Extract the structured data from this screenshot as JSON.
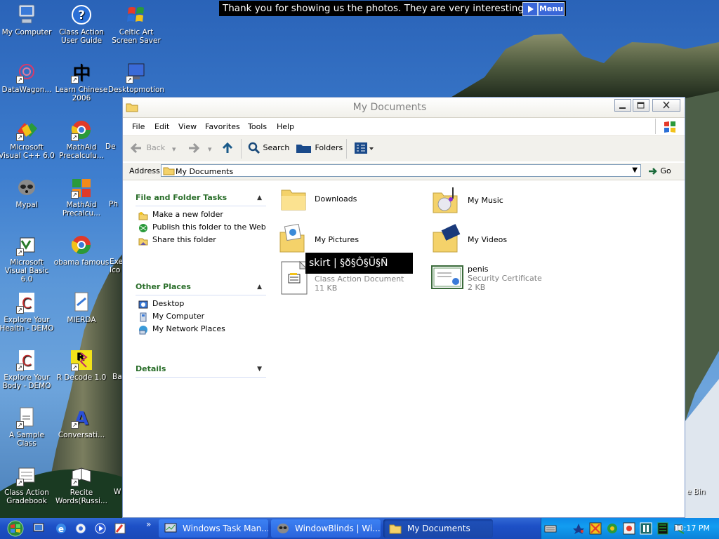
{
  "banner": {
    "text": "Thank you for showing us the photos. They are very interesting.",
    "menu_label": "Menu"
  },
  "desktop_icons": [
    {
      "label": "My Computer"
    },
    {
      "label": "Class Action User Guide"
    },
    {
      "label": "Celtic Art Screen Saver"
    },
    {
      "label": "DataWagon..."
    },
    {
      "label": "Learn Chinese 2006"
    },
    {
      "label": "Desktopmotion"
    },
    {
      "label": "Microsoft Visual C++ 6.0"
    },
    {
      "label": "MathAid Precalculu..."
    },
    {
      "label": "Mypal"
    },
    {
      "label": "MathAid Precalcu..."
    },
    {
      "label": "Microsoft Visual Basic 6.0"
    },
    {
      "label": "obama famous"
    },
    {
      "label": "Explore Your Health - DEMO"
    },
    {
      "label": "MIERDA"
    },
    {
      "label": "Explore Your Body - DEMO"
    },
    {
      "label": "R Decode 1.0"
    },
    {
      "label": "A Sample Class"
    },
    {
      "label": "Conversati..."
    },
    {
      "label": "Class Action Gradebook"
    },
    {
      "label": "Recite Words(Russi..."
    }
  ],
  "partial_icons": [
    {
      "label": "De"
    },
    {
      "label": "Ph"
    },
    {
      "label": "Exe Ico"
    },
    {
      "label": "Ba"
    },
    {
      "label": "W"
    },
    {
      "label": "e Bin"
    }
  ],
  "window": {
    "title": "My Documents",
    "menu": [
      "File",
      "Edit",
      "View",
      "Favorites",
      "Tools",
      "Help"
    ],
    "toolbar": {
      "back": "Back",
      "search": "Search",
      "folders": "Folders"
    },
    "address": {
      "label": "Address",
      "value": "My Documents",
      "go": "Go"
    },
    "tasks_panel": {
      "title": "File and Folder Tasks",
      "items": [
        "Make a new folder",
        "Publish this folder to the Web",
        "Share this folder"
      ]
    },
    "places_panel": {
      "title": "Other Places",
      "items": [
        "Desktop",
        "My Computer",
        "My Network Places"
      ]
    },
    "details_panel": {
      "title": "Details"
    },
    "files": [
      {
        "name": "Downloads"
      },
      {
        "name": "My Music"
      },
      {
        "name": "My Pictures"
      },
      {
        "name": "My Videos"
      },
      {
        "name": "",
        "type": "Class Action Document",
        "size": "11 KB"
      },
      {
        "name": "penis",
        "type": "Security Certificate",
        "size": "2 KB"
      }
    ],
    "tooltip": "skirt | §ð§Ô§Ü§Ñ"
  },
  "taskbar": {
    "buttons": [
      "Windows Task Man...",
      "WindowBlinds | Wi...",
      "My Documents"
    ],
    "clock": "10:17 PM"
  },
  "colors": {
    "link": "#215dc6",
    "taskbar": "#1d50c6",
    "tray": "#0e8ae8"
  }
}
